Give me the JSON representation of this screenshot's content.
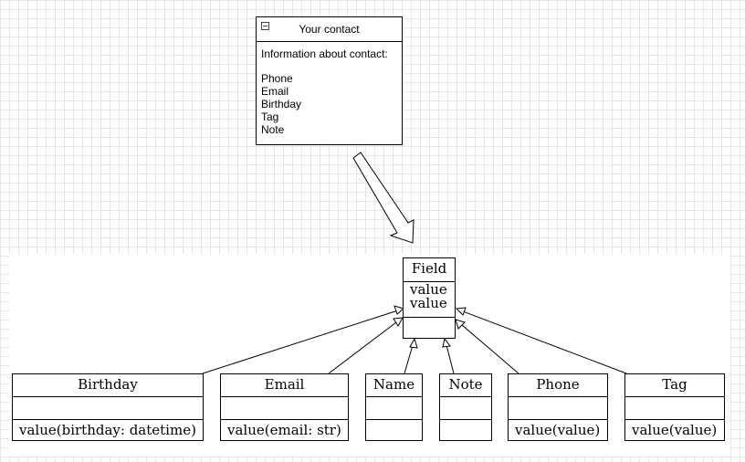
{
  "contact": {
    "title": "Your contact",
    "intro": "Information about contact:",
    "fields": [
      "Phone",
      "Email",
      "Birthday",
      "Tag",
      "Note"
    ]
  },
  "field_class": {
    "name": "Field",
    "attributes": [
      "value",
      "value"
    ]
  },
  "classes": [
    {
      "name": "Birthday",
      "method": "value(birthday: datetime)"
    },
    {
      "name": "Email",
      "method": "value(email: str)"
    },
    {
      "name": "Name",
      "method": ""
    },
    {
      "name": "Note",
      "method": ""
    },
    {
      "name": "Phone",
      "method": "value(value)"
    },
    {
      "name": "Tag",
      "method": "value(value)"
    }
  ]
}
